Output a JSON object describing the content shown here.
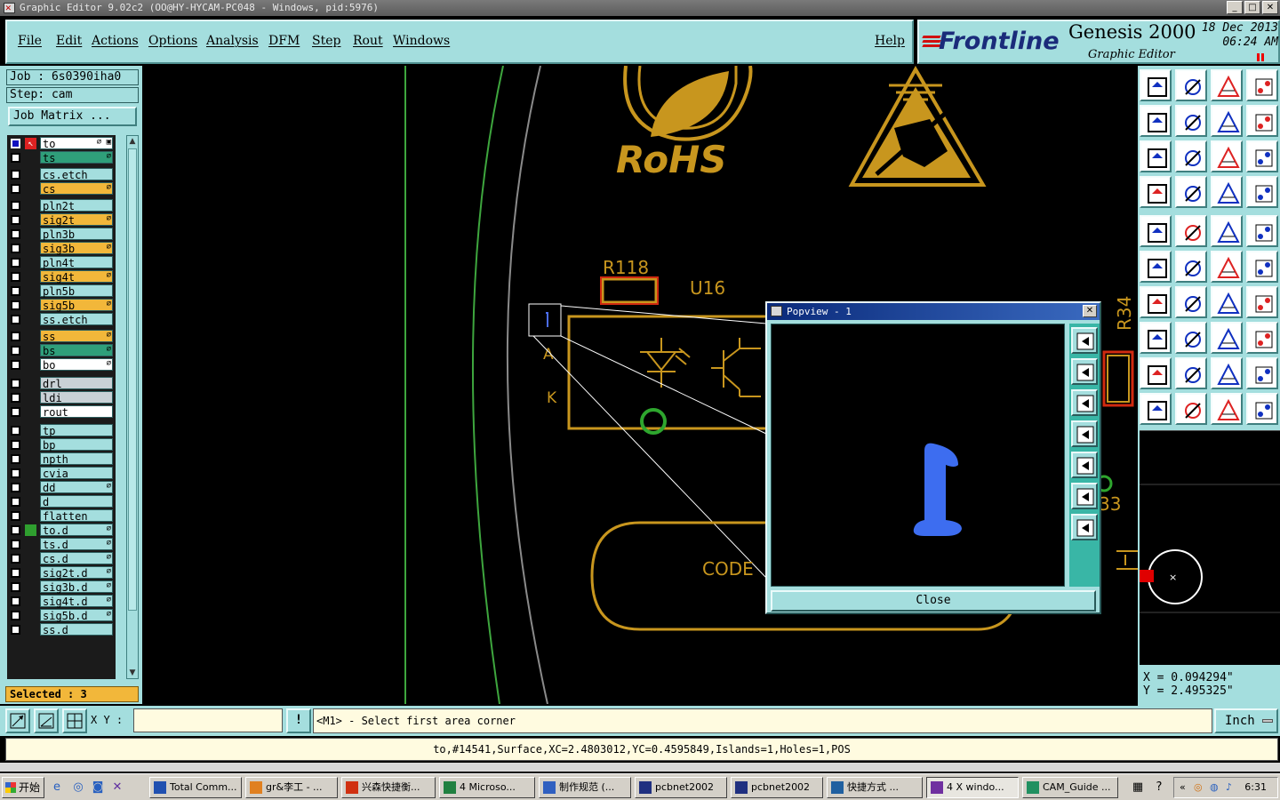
{
  "window": {
    "title": "Graphic Editor 9.02c2  (OO@HY-HYCAM-PC048 - Windows, pid:5976)",
    "minimize": "_",
    "maximize": "□",
    "close": "✕"
  },
  "menu": {
    "items": [
      "File",
      "Edit",
      "Actions",
      "Options",
      "Analysis",
      "DFM",
      "Step",
      "Rout",
      "Windows"
    ],
    "help": "Help"
  },
  "brand": {
    "logo": "Frontline",
    "product": "Genesis 2000",
    "subtitle": "Graphic Editor",
    "date": "18 Dec 2013",
    "time": "06:24 AM"
  },
  "job": {
    "job_label": "Job : 6s0390iha0",
    "step_label": "Step: cam",
    "matrix_button": "Job Matrix ..."
  },
  "layers": [
    {
      "name": "to",
      "color": "white",
      "marks": "⌀ ▣",
      "blue_checkbox": true,
      "selected_arrow": true
    },
    {
      "name": "ts",
      "color": "green",
      "marks": "⌀"
    },
    {
      "name": "cs.etch",
      "color": "cyan",
      "marks": ""
    },
    {
      "name": "cs",
      "color": "orange",
      "marks": "⌀"
    },
    {
      "name": "pln2t",
      "color": "cyan",
      "marks": ""
    },
    {
      "name": "sig2t",
      "color": "orange",
      "marks": "⌀"
    },
    {
      "name": "pln3b",
      "color": "cyan",
      "marks": ""
    },
    {
      "name": "sig3b",
      "color": "orange",
      "marks": "⌀"
    },
    {
      "name": "pln4t",
      "color": "cyan",
      "marks": ""
    },
    {
      "name": "sig4t",
      "color": "orange",
      "marks": "⌀"
    },
    {
      "name": "pln5b",
      "color": "cyan",
      "marks": ""
    },
    {
      "name": "sig5b",
      "color": "orange",
      "marks": "⌀"
    },
    {
      "name": "ss.etch",
      "color": "cyan",
      "marks": ""
    },
    {
      "name": "ss",
      "color": "orange",
      "marks": "⌀"
    },
    {
      "name": "bs",
      "color": "green",
      "marks": "⌀"
    },
    {
      "name": "bo",
      "color": "white",
      "marks": "⌀"
    },
    {
      "name": "drl",
      "color": "gray",
      "marks": ""
    },
    {
      "name": "ldi",
      "color": "gray",
      "marks": ""
    },
    {
      "name": "rout",
      "color": "white",
      "marks": ""
    },
    {
      "name": "tp",
      "color": "cyan",
      "marks": ""
    },
    {
      "name": "bp",
      "color": "cyan",
      "marks": ""
    },
    {
      "name": "npth",
      "color": "cyan",
      "marks": ""
    },
    {
      "name": "cvia",
      "color": "cyan",
      "marks": ""
    },
    {
      "name": "dd",
      "color": "cyan",
      "marks": "⌀"
    },
    {
      "name": "d",
      "color": "cyan",
      "marks": ""
    },
    {
      "name": "flatten",
      "color": "cyan",
      "marks": ""
    },
    {
      "name": "to.d",
      "color": "cyan",
      "marks": "⌀",
      "green_square": true
    },
    {
      "name": "ts.d",
      "color": "cyan",
      "marks": "⌀"
    },
    {
      "name": "cs.d",
      "color": "cyan",
      "marks": "⌀"
    },
    {
      "name": "sig2t.d",
      "color": "cyan",
      "marks": "⌀"
    },
    {
      "name": "sig3b.d",
      "color": "cyan",
      "marks": "⌀"
    },
    {
      "name": "sig4t.d",
      "color": "cyan",
      "marks": "⌀"
    },
    {
      "name": "sig5b.d",
      "color": "cyan",
      "marks": "⌀"
    },
    {
      "name": "ss.d",
      "color": "cyan",
      "marks": ""
    }
  ],
  "selected_text": "Selected : 3",
  "board": {
    "labels": {
      "rohs": "RoHS",
      "r118": "R118",
      "u16": "U16",
      "anode": "A",
      "cathode": "K",
      "code": "CODE",
      "r34": "R34",
      "r33": "33"
    }
  },
  "popview": {
    "title": "Popview - 1",
    "close_button": "Close"
  },
  "coords": {
    "x": "X = 0.094294\"",
    "y": "Y = 2.495325\""
  },
  "command": {
    "xy_label": "X Y :",
    "xy_value": "",
    "bang": "!",
    "prompt": "<M1> - Select first area corner",
    "unit": "Inch"
  },
  "status": "to,#14541,Surface,XC=2.4803012,YC=0.4595849,Islands=1,Holes=1,POS",
  "taskbar": {
    "start": "开始",
    "tasks": [
      "Total Comm...",
      "gr&李工 - ...",
      "兴森快捷衡...",
      "4 Microso...",
      "制作规范 (...",
      "pcbnet2002",
      "pcbnet2002",
      "快捷方式 ...",
      "4 X windo...",
      "CAM_Guide ..."
    ],
    "clock": "6:31"
  },
  "colors": {
    "panel": "#a4dede",
    "board_gold": "#c8961e",
    "orange_layer": "#f2b73a",
    "green_layer": "#2f9f7a",
    "popview_shape": "#3d6df0"
  }
}
